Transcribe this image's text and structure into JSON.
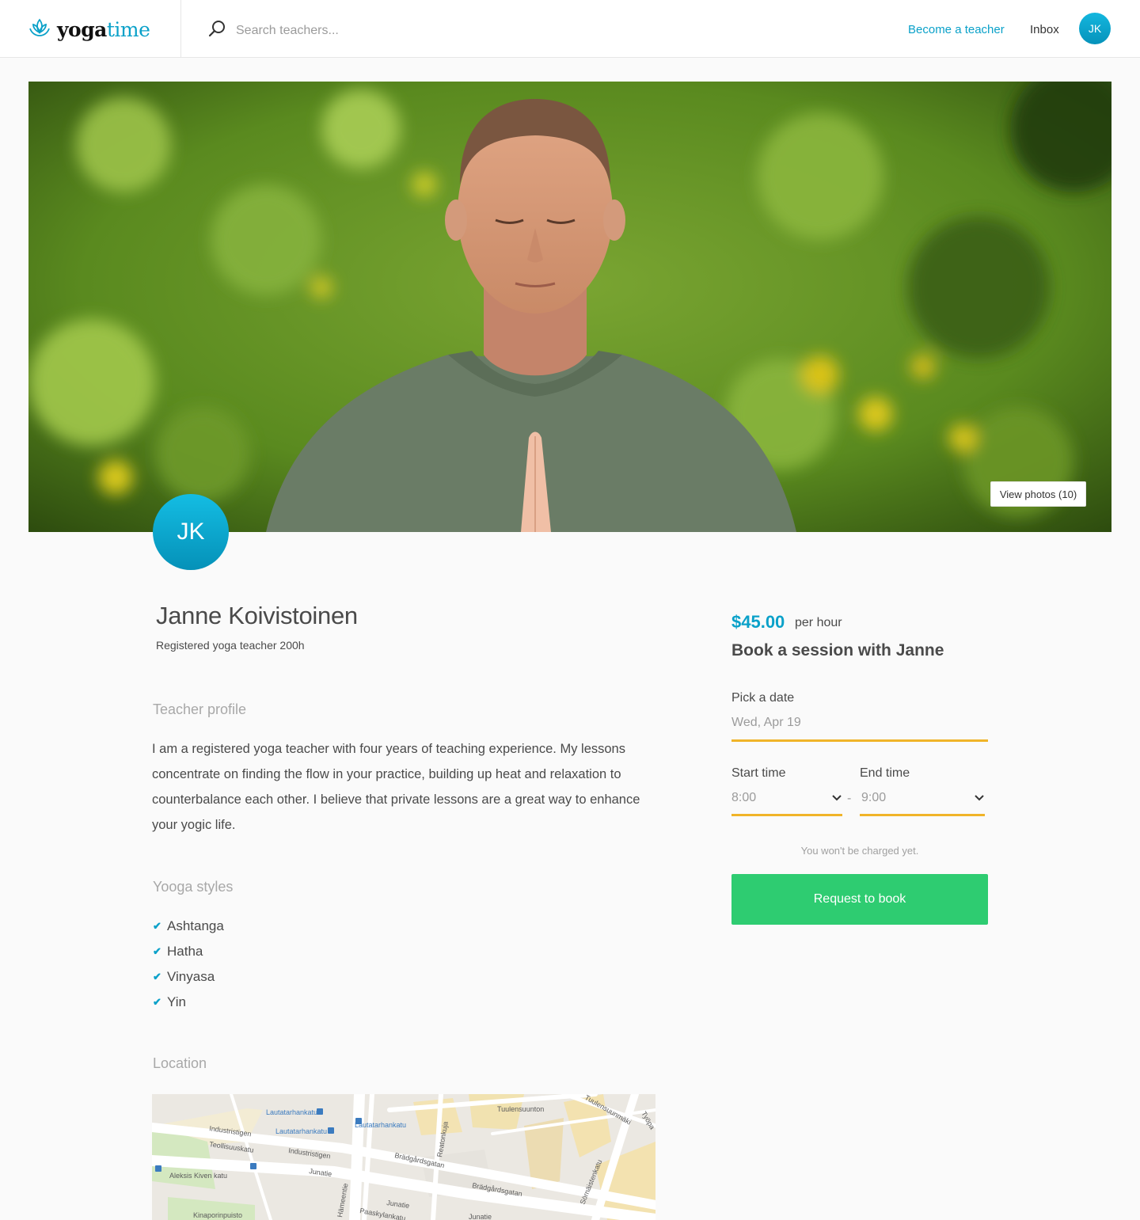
{
  "app": {
    "logo_part1": "yoga",
    "logo_part2": "time",
    "brand_color": "#0aa1c9",
    "accent_color": "#f0b429",
    "cta_color": "#2ecc71"
  },
  "header": {
    "search_placeholder": "Search teachers...",
    "become_teacher": "Become a teacher",
    "inbox": "Inbox",
    "user_initials": "JK"
  },
  "hero": {
    "view_photos": "View photos (10)"
  },
  "teacher": {
    "initials": "JK",
    "name": "Janne Koivistoinen",
    "subtitle": "Registered yoga teacher 200h",
    "profile_heading": "Teacher profile",
    "bio": "I am a registered yoga teacher with four years of teaching experience. My lessons concentrate on finding the flow in your practice, building up heat and relaxation to counterbalance each other. I believe that private lessons are a great way to enhance your yogic life.",
    "styles_heading": "Yooga styles",
    "styles": [
      "Ashtanga",
      "Hatha",
      "Vinyasa",
      "Yin"
    ],
    "location_heading": "Location"
  },
  "map": {
    "labels": [
      "Lautatarhankatu",
      "Lautatarhankatu",
      "Lautatarhankatu",
      "Tuulensuunton",
      "Industristigen",
      "Teollisuuskatu",
      "Industristigen",
      "Brädgårdsgatan",
      "Reatonkuja",
      "Aleksis Kiven katu",
      "Junatie",
      "Brädgårdsgatan",
      "Sörnäistenkatu",
      "Junatie",
      "Hämeentie",
      "Kinaporinpuisto",
      "Paaskylankatu",
      "Junatie",
      "Tuulensuunmäki",
      "Työpa"
    ]
  },
  "booking": {
    "price": "$45.00",
    "per_hour": "per hour",
    "title": "Book a session with Janne",
    "date_label": "Pick a date",
    "date_value": "Wed, Apr 19",
    "start_label": "Start time",
    "start_value": "8:00",
    "end_label": "End time",
    "end_value": "9:00",
    "dash": "-",
    "note": "You won't be charged yet.",
    "button": "Request to book"
  }
}
